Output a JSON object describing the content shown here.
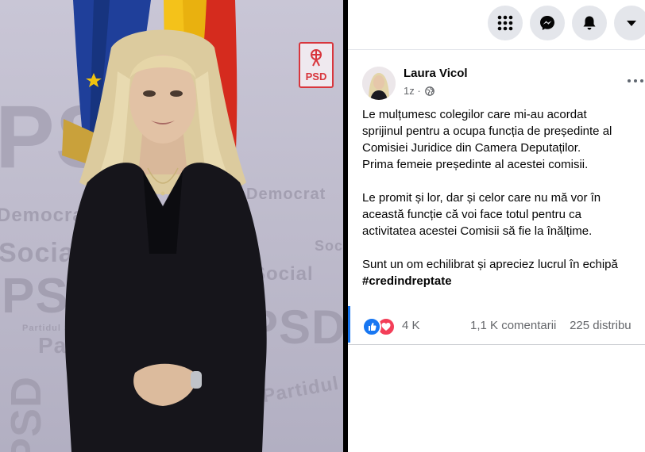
{
  "photo": {
    "logo_text": "PSD",
    "watermarks": [
      "PS",
      "PSD",
      "Democrat",
      "Democrat",
      "Social",
      "Partidul",
      "Partidul",
      "PSD",
      "PSD",
      "Partidul Social",
      "Social",
      "Social"
    ]
  },
  "topbar": {
    "icons": [
      "apps-menu-icon",
      "messenger-icon",
      "notifications-bell-icon",
      "account-caret-icon"
    ]
  },
  "post": {
    "author": "Laura Vicol",
    "time": "1z",
    "audience_icon": "globe-icon",
    "paragraphs": [
      [
        "Le mulțumesc colegilor care mi-au acordat",
        "sprijinul pentru a ocupa funcția de președinte al",
        "Comisiei Juridice din Camera Deputaților.",
        "Prima femeie președinte al acestei comisii."
      ],
      [
        "Le promit și lor, dar și celor care nu mă vor în",
        "această funcție că voi face totul pentru ca",
        "activitatea acestei Comisii să fie la înălțime."
      ],
      [
        "Sunt un om echilibrat și apreciez lucrul în echipă"
      ]
    ],
    "hashtag": "#credindreptate",
    "reactions": [
      "like-icon",
      "love-icon"
    ],
    "reaction_count": "4 K",
    "comments": "1,1 K comentarii",
    "shares": "225 distribu"
  },
  "colors": {
    "like_blue": "#1877f2",
    "love_red": "#f33e58",
    "psd_red": "#d8363d"
  }
}
